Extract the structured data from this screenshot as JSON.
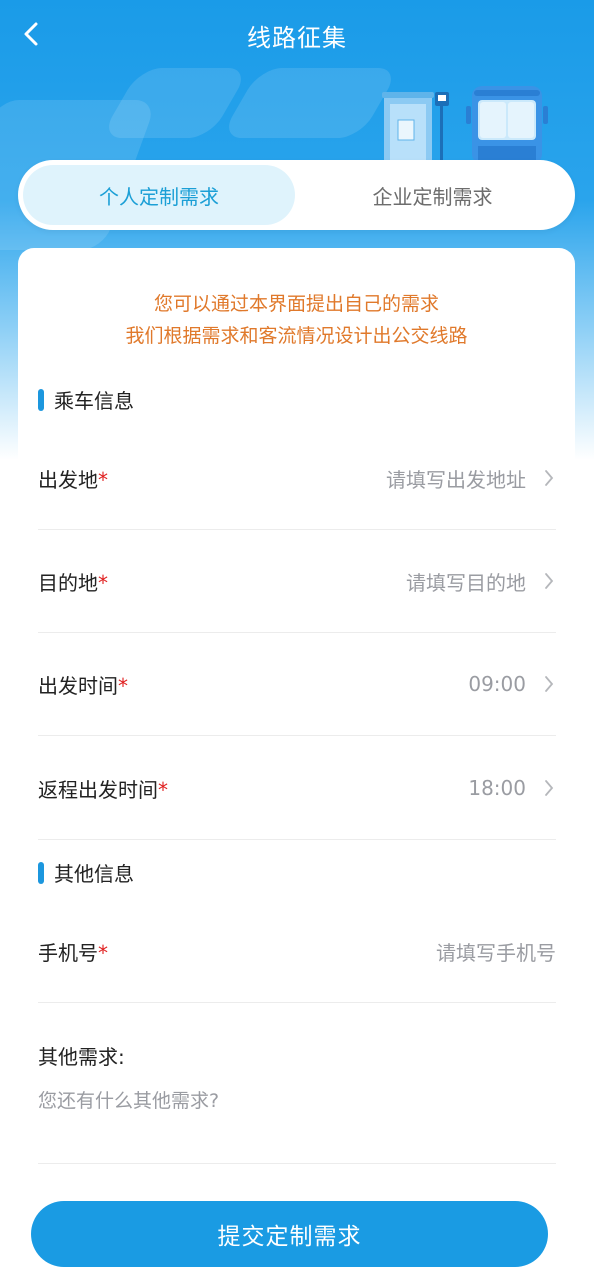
{
  "header": {
    "title": "线路征集",
    "back_icon": "chevron-left-icon"
  },
  "tabs": [
    {
      "label": "个人定制需求",
      "active": true
    },
    {
      "label": "企业定制需求",
      "active": false
    }
  ],
  "notice": {
    "line1": "您可以通过本界面提出自己的需求",
    "line2": "我们根据需求和客流情况设计出公交线路"
  },
  "sections": {
    "ride_info": "乘车信息",
    "other_info": "其他信息"
  },
  "fields": {
    "origin": {
      "label": "出发地",
      "required": "*",
      "placeholder": "请填写出发地址"
    },
    "destination": {
      "label": "目的地",
      "required": "*",
      "placeholder": "请填写目的地"
    },
    "depart_time": {
      "label": "出发时间",
      "required": "*",
      "value": "09:00"
    },
    "return_time": {
      "label": "返程出发时间",
      "required": "*",
      "value": "18:00"
    },
    "phone": {
      "label": "手机号",
      "required": "*",
      "placeholder": "请填写手机号"
    },
    "other_needs": {
      "label": "其他需求:",
      "placeholder": "您还有什么其他需求?"
    }
  },
  "submit": {
    "label": "提交定制需求"
  },
  "colors": {
    "primary": "#1a9be3",
    "notice": "#e0792b",
    "required": "#e02020",
    "active_tab_bg": "#dff3fc"
  }
}
